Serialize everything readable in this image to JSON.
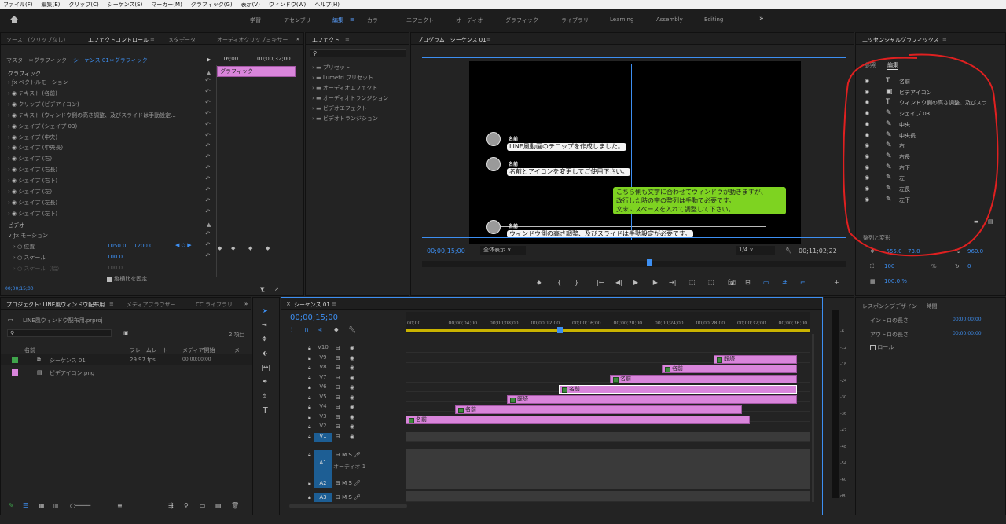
{
  "menu": [
    "ファイル(F)",
    "編集(E)",
    "クリップ(C)",
    "シーケンス(S)",
    "マーカー(M)",
    "グラフィック(G)",
    "表示(V)",
    "ウィンドウ(W)",
    "ヘルプ(H)"
  ],
  "workspaces": [
    "学習",
    "アセンブリ",
    "編集",
    "カラー",
    "エフェクト",
    "オーディオ",
    "グラフィック",
    "ライブラリ",
    "Learning",
    "Assembly",
    "Editing"
  ],
  "source_tabs": [
    "ソース：(クリップなし)",
    "エフェクトコントロール",
    "メタデータ",
    "オーディオクリップミキサー"
  ],
  "ec": {
    "master": "マスター＊グラフィック",
    "seq": "シーケンス 01＊グラフィック",
    "time1": "16;00",
    "time2": "00;00;32;00",
    "graphic_label": "グラフィック",
    "clip_label": "グラフィック",
    "video_label": "ビデオ",
    "position_label": "位置",
    "pos_x": "1050.0",
    "pos_y": "1200.0",
    "scale_label": "スケール",
    "scale_val": "100.0",
    "scalew_label": "スケール（幅）",
    "scalew_val": "100.0",
    "uniform": "縦横比を固定",
    "time": "00;00;15;00",
    "motion": "モーション"
  },
  "ec_items": [
    "ベクトルモーション",
    "テキスト (名前)",
    "クリップ (ビデアイコン)",
    "テキスト (ウィンドウ側の高さ調整、及びスライドは手動設定...",
    "シェイプ (シェイプ 03)",
    "シェイプ (中央)",
    "シェイプ (中央長)",
    "シェイプ (右)",
    "シェイプ (右長)",
    "シェイプ (右下)",
    "シェイプ (左)",
    "シェイプ (左長)",
    "シェイプ (左下)"
  ],
  "effects": {
    "title": "エフェクト",
    "items": [
      "プリセット",
      "Lumetri プリセット",
      "オーディオエフェクト",
      "オーディオトランジション",
      "ビデオエフェクト",
      "ビデオトランジション"
    ]
  },
  "program": {
    "title": "プログラム：シーケンス 01",
    "timecode": "00;00;15;00",
    "fit": "全体表示",
    "quality": "1/4",
    "duration": "00;11;02;22",
    "chats": [
      {
        "name": "名前",
        "text": "LINE風動画のテロップを作成しました。"
      },
      {
        "name": "名前",
        "text": "名前とアイコンを変更してご使用下さい。"
      },
      {
        "name": "名前",
        "text": "ウィンドウ側の高さ調整、及びスライドは手動設定が必要です。"
      }
    ],
    "green_lines": [
      "こちら側も文字に合わせてウィンドウが動きますが、",
      "改行した時の字の整列は手動で必要です。",
      "文末にスペースを入れて調整して下さい。"
    ]
  },
  "eg": {
    "title": "エッセンシャルグラフィックス",
    "tabs": [
      "参照",
      "編集"
    ],
    "layers": [
      "名前",
      "ビデアイコン",
      "ウィンドウ側の高さ調整、及びスラ...",
      "シェイプ 03",
      "中央",
      "中央長",
      "右",
      "右長",
      "右下",
      "左",
      "左長",
      "左下"
    ],
    "align": "整列と変形",
    "x": "-555.0",
    "y": "73.0",
    "rx": "960.0",
    "ry": "0",
    "scale": "100",
    "rot": "0",
    "opacity": "100.0 %",
    "responsive": "レスポンシブデザイン － 時間",
    "intro": "イントロの長さ",
    "outro": "アウトロの長さ",
    "intro_val": "00;00;00;00",
    "outro_val": "00;00;00;00",
    "roll": "ロール"
  },
  "project": {
    "tabs": [
      "プロジェクト: LINE風ウィンドウ配布用",
      "メディアブラウザー",
      "CC ライブラリ"
    ],
    "file": "LINE風ウィンドウ配布用.prproj",
    "count": "2 項目",
    "cols": [
      "名前",
      "フレームレート",
      "メディア開始",
      "メ"
    ],
    "items": [
      {
        "name": "シーケンス 01",
        "fps": "29.97 fps",
        "start": "00;00;00;00",
        "color": "#3fa44b"
      },
      {
        "name": "ビデアイコン.png",
        "fps": "",
        "start": "",
        "color": "#d985db"
      }
    ]
  },
  "timeline": {
    "tab": "シーケンス 01",
    "timecode": "00;00;15;00",
    "ruler": [
      "00;00",
      "00;00;04;00",
      "00;00;08;00",
      "00;00;12;00",
      "00;00;16;00",
      "00;00;20;00",
      "00;00;24;00",
      "00;00;28;00",
      "00;00;32;00",
      "00;00;36;00"
    ],
    "vtracks": [
      "V10",
      "V9",
      "V8",
      "V7",
      "V6",
      "V5",
      "V4",
      "V3",
      "V2",
      "V1"
    ],
    "atracks": [
      "A1",
      "A2",
      "A3"
    ],
    "audio_label": "オーディオ 1",
    "clips": [
      {
        "label": "既読"
      },
      {
        "label": "名前"
      },
      {
        "label": "名前"
      },
      {
        "label": "名前"
      },
      {
        "label": "既読"
      },
      {
        "label": "名前"
      },
      {
        "label": "名前"
      }
    ],
    "meter": [
      "-6",
      "-12",
      "-18",
      "-24",
      "-30",
      "-36",
      "-42",
      "-48",
      "-54",
      "-60",
      "dB"
    ]
  },
  "colors": {
    "accent": "#3d8ff2",
    "clip": "#d985db",
    "green_chat": "#7ed321",
    "red_annotation": "#e02020"
  }
}
